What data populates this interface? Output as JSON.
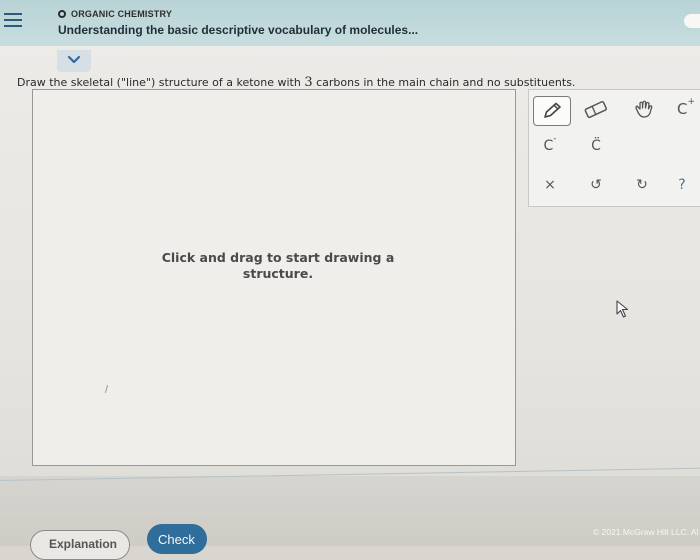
{
  "header": {
    "category": "ORGANIC CHEMISTRY",
    "title": "Understanding the basic descriptive vocabulary of molecules..."
  },
  "question": {
    "text_before": "Draw the skeletal (\"line\") structure of a ketone with ",
    "number": "3",
    "text_after": " carbons in the main chain and no substituents."
  },
  "canvas": {
    "hint": "Click and drag to start drawing a structure."
  },
  "toolbar": {
    "tools": [
      {
        "name": "pencil",
        "icon": "pencil-icon",
        "selected": true
      },
      {
        "name": "eraser",
        "icon": "eraser-icon"
      },
      {
        "name": "hand",
        "icon": "hand-icon"
      },
      {
        "name": "carbocation",
        "label": "C",
        "sup": "+"
      },
      {
        "name": "carbanion",
        "label": "C",
        "sup": "-"
      },
      {
        "name": "lone-pair",
        "label": "C̈"
      },
      {
        "name": "clear",
        "label": "×"
      },
      {
        "name": "undo",
        "label": "↺"
      },
      {
        "name": "redo",
        "label": "↻"
      },
      {
        "name": "help",
        "label": "?"
      }
    ]
  },
  "footer": {
    "explain_label": "Explanation",
    "check_label": "Check",
    "copyright": "© 2021 McGraw Hill LLC. Al"
  },
  "colors": {
    "header_bg": "#bfd7da",
    "check_button": "#2f6d9a",
    "hamburger": "#2f5a77",
    "help": "#3c78a8"
  }
}
